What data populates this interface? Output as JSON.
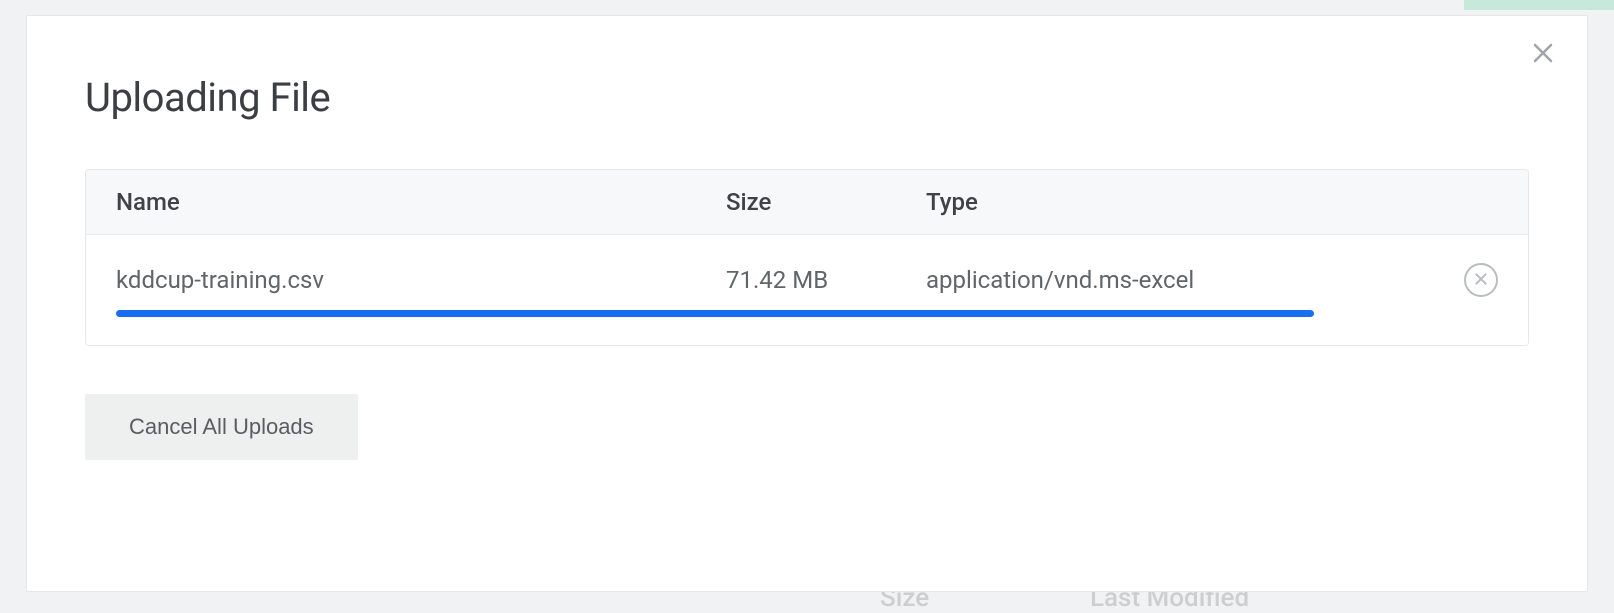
{
  "modal": {
    "title": "Uploading File",
    "close_aria": "Close"
  },
  "columns": {
    "name": "Name",
    "size": "Size",
    "type": "Type"
  },
  "uploads": [
    {
      "name": "kddcup-training.csv",
      "size": "71.42 MB",
      "type": "application/vnd.ms-excel",
      "progress_percent": 100
    }
  ],
  "actions": {
    "cancel_all": "Cancel All Uploads",
    "cancel_item_aria": "Cancel upload"
  },
  "background": {
    "col_size": "Size",
    "col_modified": "Last Modified"
  }
}
